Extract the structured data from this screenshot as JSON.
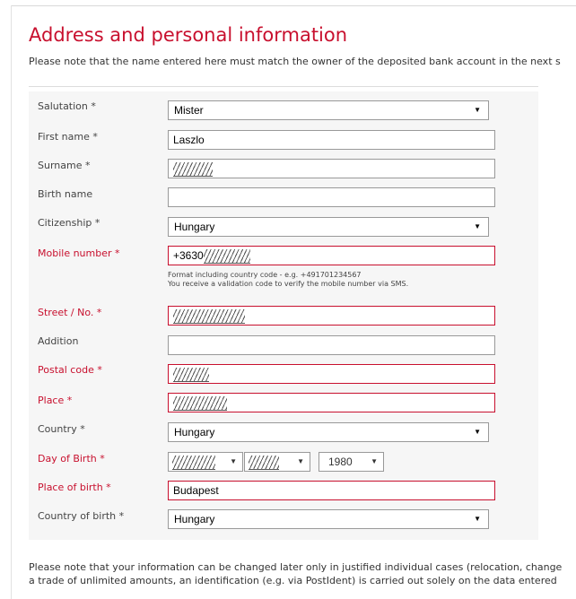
{
  "section": {
    "title": "Address and personal information",
    "note": "Please note that the name entered here must match the owner of the deposited bank account in the next s"
  },
  "form": {
    "salutation": {
      "label": "Salutation *",
      "value": "Mister"
    },
    "first_name": {
      "label": "First name *",
      "value": "Laszlo"
    },
    "surname": {
      "label": "Surname *",
      "value": ""
    },
    "birth_name": {
      "label": "Birth name",
      "value": ""
    },
    "citizenship": {
      "label": "Citizenship *",
      "value": "Hungary"
    },
    "mobile": {
      "label": "Mobile number *",
      "value": "+3630",
      "help1": "Format including country code - e.g. +491701234567",
      "help2": "You receive a validation code to verify the mobile number via SMS."
    },
    "street": {
      "label": "Street / No. *",
      "value": ""
    },
    "addition": {
      "label": "Addition",
      "value": ""
    },
    "postal_code": {
      "label": "Postal code *",
      "value": ""
    },
    "place": {
      "label": "Place *",
      "value": ""
    },
    "country": {
      "label": "Country *",
      "value": "Hungary"
    },
    "day_of_birth": {
      "label": "Day of Birth *",
      "day": "",
      "month": "",
      "year": "1980"
    },
    "place_of_birth": {
      "label": "Place of birth *",
      "value": "Budapest"
    },
    "country_of_birth": {
      "label": "Country of birth *",
      "value": "Hungary"
    }
  },
  "footer": {
    "line1": "Please note that your information can be changed later only in justified individual cases (relocation, change",
    "line2": "a trade of unlimited amounts, an identification (e.g. via PostIdent) is carried out solely on the data entered"
  },
  "colors": {
    "accent": "#c8102e",
    "panel": "#f6f6f6"
  }
}
